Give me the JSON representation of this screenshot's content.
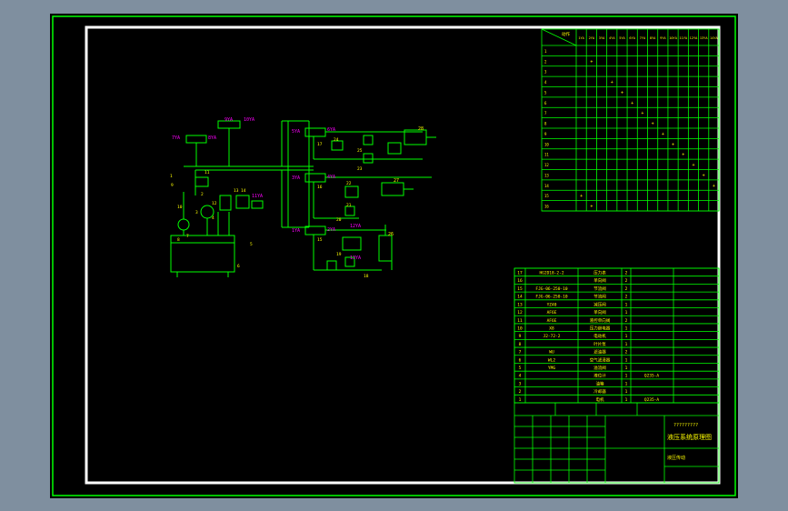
{
  "colors": {
    "background": "#000000",
    "outer_frame": "#00ff00",
    "inner_frame": "#ffffff",
    "grid": "#00ff00",
    "text": "#ffff00",
    "label": "#ff00ff"
  },
  "schematic": {
    "valve_top": {
      "coil_a": "9YA",
      "coil_b": "10YA"
    },
    "valve_left": {
      "coil_a": "7YA",
      "coil_b": "8YA"
    },
    "valve_1": {
      "coil_a": "5YA",
      "coil_b": "6YA"
    },
    "valve_2": {
      "coil_a": "3YA",
      "coil_b": "4YA"
    },
    "valve_3": {
      "coil_a": "1YA",
      "coil_b": "2YA"
    },
    "pressure_switch": "11YA",
    "branch_labels": [
      "12YA",
      "13YA"
    ],
    "cylinder_tags": [
      "28",
      "27",
      "26"
    ],
    "component_numbers": [
      "24",
      "25",
      "23",
      "22",
      "21",
      "20",
      "19",
      "18",
      "17",
      "16",
      "15",
      "14",
      "13",
      "12",
      "11",
      "10",
      "9",
      "8",
      "7",
      "6",
      "5",
      "4",
      "3",
      "2",
      "1"
    ]
  },
  "action_table": {
    "header_corner": "动作",
    "columns": [
      "1YA",
      "2YA",
      "3YA",
      "4YA",
      "5YA",
      "6YA",
      "7YA",
      "8YA",
      "9YA",
      "10YA",
      "11YA",
      "12YA",
      "13YA",
      "14YA"
    ],
    "rows": [
      {
        "label": "1",
        "marks": []
      },
      {
        "label": "2",
        "marks": [
          "+"
        ]
      },
      {
        "label": "3",
        "marks": []
      },
      {
        "label": "4",
        "marks": [
          "+"
        ]
      },
      {
        "label": "5",
        "marks": [
          "+"
        ]
      },
      {
        "label": "6",
        "marks": [
          "+"
        ]
      },
      {
        "label": "7",
        "marks": [
          "+"
        ]
      },
      {
        "label": "8",
        "marks": [
          "+"
        ]
      },
      {
        "label": "9",
        "marks": [
          "+"
        ]
      },
      {
        "label": "10",
        "marks": [
          "+"
        ]
      },
      {
        "label": "11",
        "marks": [
          "+"
        ]
      },
      {
        "label": "12",
        "marks": [
          "+"
        ]
      },
      {
        "label": "13",
        "marks": [
          "+"
        ]
      },
      {
        "label": "14",
        "marks": [
          "+"
        ]
      },
      {
        "label": "15",
        "marks": [
          "+"
        ]
      },
      {
        "label": "16",
        "marks": [
          "+"
        ]
      }
    ]
  },
  "parts_list": {
    "rows": [
      {
        "no": "17",
        "code": "HG2D18-2-2",
        "name": "压力表",
        "qty": "2",
        "note": ""
      },
      {
        "no": "16",
        "code": "",
        "name": "单向阀",
        "qty": "2",
        "note": ""
      },
      {
        "no": "15",
        "code": "FJG-06-250-10",
        "name": "节流阀",
        "qty": "2",
        "note": ""
      },
      {
        "no": "14",
        "code": "FJG-06-250-10",
        "name": "节流阀",
        "qty": "2",
        "note": ""
      },
      {
        "no": "13",
        "code": "YZ40",
        "name": "减压阀",
        "qty": "1",
        "note": ""
      },
      {
        "no": "12",
        "code": "AF6E",
        "name": "单向阀",
        "qty": "1",
        "note": ""
      },
      {
        "no": "11",
        "code": "AF6E",
        "name": "液控单向阀",
        "qty": "2",
        "note": ""
      },
      {
        "no": "10",
        "code": "X8",
        "name": "压力继电器",
        "qty": "1",
        "note": ""
      },
      {
        "no": "9",
        "code": "J2-72-2",
        "name": "电动机",
        "qty": "1",
        "note": ""
      },
      {
        "no": "8",
        "code": "",
        "name": "叶片泵",
        "qty": "1",
        "note": ""
      },
      {
        "no": "7",
        "code": "WU",
        "name": "滤油器",
        "qty": "2",
        "note": ""
      },
      {
        "no": "6",
        "code": "WL2",
        "name": "空气滤清器",
        "qty": "1",
        "note": ""
      },
      {
        "no": "5",
        "code": "YMG",
        "name": "溢流阀",
        "qty": "1",
        "note": ""
      },
      {
        "no": "4",
        "code": "",
        "name": "液位计",
        "qty": "1",
        "note": "Q235-A"
      },
      {
        "no": "3",
        "code": "",
        "name": "油箱",
        "qty": "1",
        "note": ""
      },
      {
        "no": "2",
        "code": "",
        "name": "冷却器",
        "qty": "1",
        "note": ""
      },
      {
        "no": "1",
        "code": "",
        "name": "电机",
        "qty": "1",
        "note": "Q235-A"
      }
    ]
  },
  "title_block": {
    "drawing_code": "?????????",
    "title": "液压系统原理图",
    "subtitle": "液压传动"
  }
}
